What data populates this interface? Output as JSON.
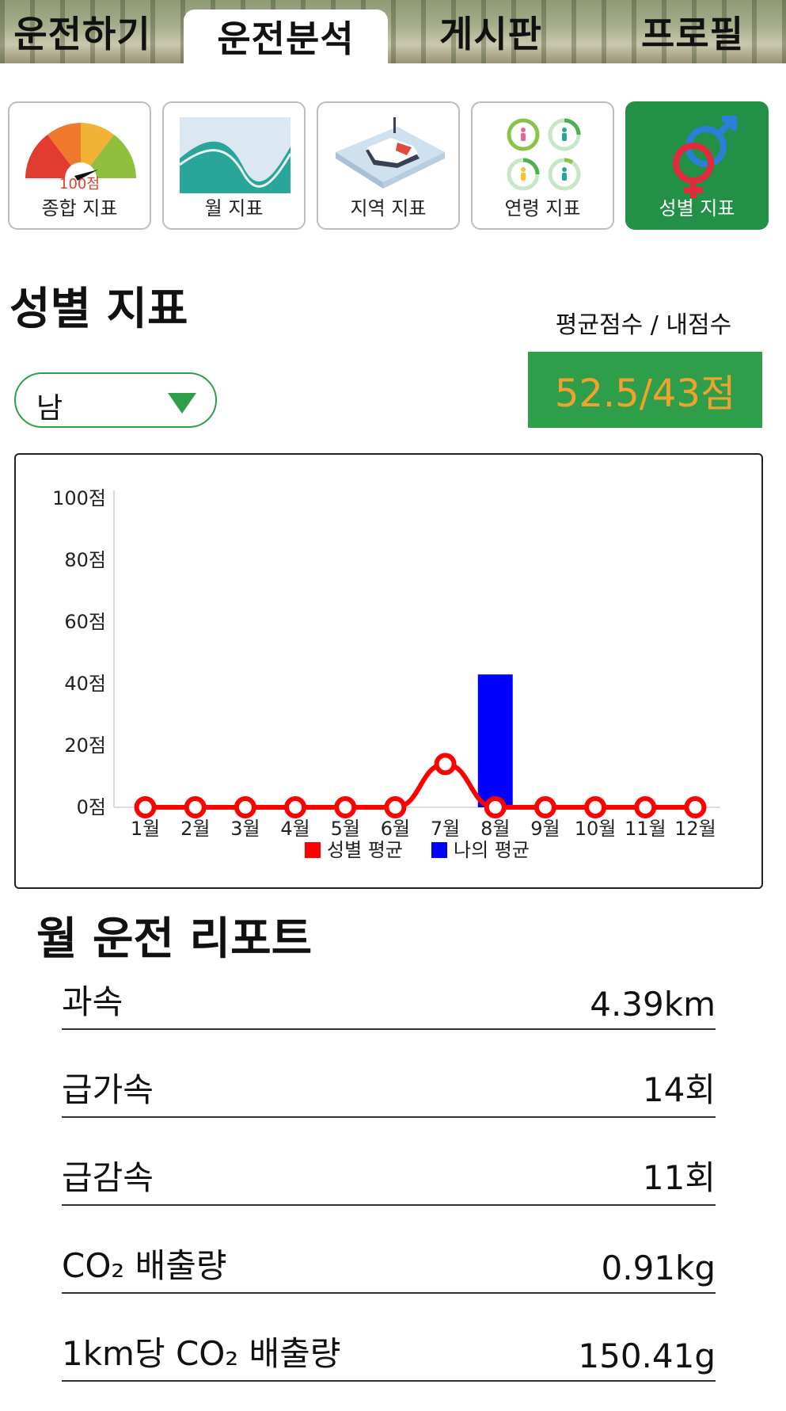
{
  "tabs": [
    {
      "label": "운전하기"
    },
    {
      "label": "운전분석"
    },
    {
      "label": "게시판"
    },
    {
      "label": "프로필"
    }
  ],
  "categories": [
    {
      "label": "종합 지표",
      "icon": "gauge-icon",
      "gauge_text": "100점"
    },
    {
      "label": "월 지표",
      "icon": "wave-chart-icon"
    },
    {
      "label": "지역 지표",
      "icon": "region-map-icon"
    },
    {
      "label": "연령 지표",
      "icon": "age-people-icon"
    },
    {
      "label": "성별 지표",
      "icon": "gender-symbol-icon"
    }
  ],
  "section": {
    "title": "성별 지표",
    "score_caption": "평균점수 / 내점수",
    "score_value": "52.5/43점",
    "gender_selected": "남"
  },
  "colors": {
    "green": "#2e9e4a",
    "score_text": "#f2a12d",
    "series_gender_avg": "#ff0000",
    "series_my_avg": "#0000ff"
  },
  "chart_data": {
    "type": "line",
    "categories": [
      "1월",
      "2월",
      "3월",
      "4월",
      "5월",
      "6월",
      "7월",
      "8월",
      "9월",
      "10월",
      "11월",
      "12월"
    ],
    "series": [
      {
        "name": "성별 평균",
        "type": "line",
        "values": [
          0,
          0,
          0,
          0,
          0,
          0,
          14,
          0,
          0,
          0,
          0,
          0
        ]
      },
      {
        "name": "나의 평균",
        "type": "bar",
        "values": [
          0,
          0,
          0,
          0,
          0,
          0,
          0,
          43,
          0,
          0,
          0,
          0
        ]
      }
    ],
    "y_ticks": [
      "0점",
      "20점",
      "40점",
      "60점",
      "80점",
      "100점"
    ],
    "ylim": [
      0,
      100
    ],
    "legend": "bottom",
    "grid": false
  },
  "report": {
    "title": "월 운전 리포트",
    "rows": [
      {
        "label": "과속",
        "value": "4.39km"
      },
      {
        "label": "급가속",
        "value": "14회"
      },
      {
        "label": "급감속",
        "value": "11회"
      },
      {
        "label": "CO₂ 배출량",
        "value": "0.91kg"
      },
      {
        "label": "1km당 CO₂ 배출량",
        "value": "150.41g"
      }
    ]
  }
}
